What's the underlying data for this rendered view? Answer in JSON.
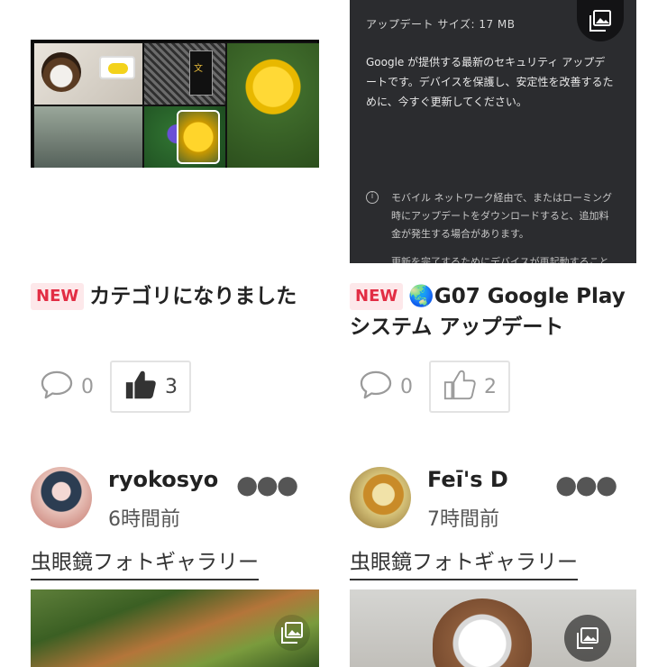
{
  "cards": [
    {
      "badge": "NEW",
      "title": "カテゴリになりました",
      "comments": "0",
      "likes": "3"
    },
    {
      "badge": "NEW",
      "title": "🌏G07 Google Play システム アップデート",
      "comments": "0",
      "likes": "2",
      "screenshot": {
        "update_size": "アップデート サイズ: 17 MB",
        "description": "Google が提供する最新のセキュリティ アップデートです。デバイスを保護し、安定性を改善するために、今すぐ更新してください。",
        "note": "モバイル ネットワーク経由で、またはローミング時にアップデートをダウンロードすると、追加料金が発生する場合があります。",
        "note_cut": "更新を完了するためにデバイスが再起動すること"
      }
    }
  ],
  "posts": [
    {
      "username": "ryokosyo",
      "time": "6時間前",
      "category": "虫眼鏡フォトギャラリー"
    },
    {
      "username": "Feī's D",
      "time": "7時間前",
      "category": "虫眼鏡フォトギャラリー"
    }
  ],
  "icons": {
    "comment": "speech-bubble-icon",
    "like": "thumbs-up-icon",
    "gallery": "gallery-icon",
    "more": "more-dots-icon",
    "info": "info-icon"
  },
  "colors": {
    "badge_text": "#e22d44",
    "badge_bg": "#fde8ea",
    "dark_screenshot_bg": "#2b2c2f"
  }
}
